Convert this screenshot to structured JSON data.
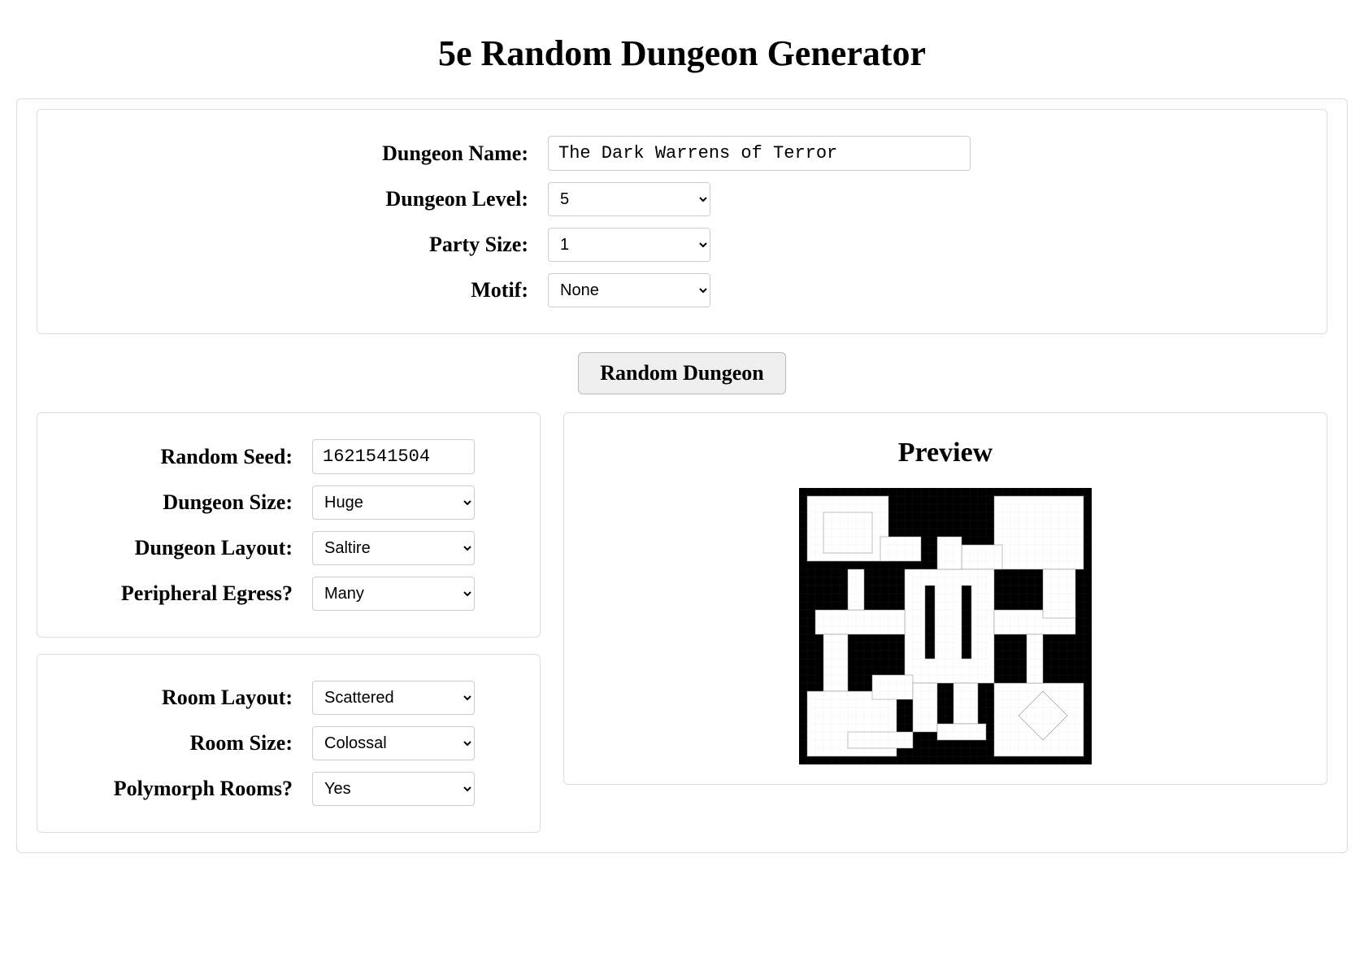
{
  "page_title": "5e Random Dungeon Generator",
  "top": {
    "dungeon_name_label": "Dungeon Name:",
    "dungeon_name_value": "The Dark Warrens of Terror",
    "dungeon_level_label": "Dungeon Level:",
    "dungeon_level_value": "5",
    "party_size_label": "Party Size:",
    "party_size_value": "1",
    "motif_label": "Motif:",
    "motif_value": "None"
  },
  "random_button": "Random Dungeon",
  "left1": {
    "random_seed_label": "Random Seed:",
    "random_seed_value": "1621541504",
    "dungeon_size_label": "Dungeon Size:",
    "dungeon_size_value": "Huge",
    "dungeon_layout_label": "Dungeon Layout:",
    "dungeon_layout_value": "Saltire",
    "peripheral_egress_label": "Peripheral Egress?",
    "peripheral_egress_value": "Many"
  },
  "left2": {
    "room_layout_label": "Room Layout:",
    "room_layout_value": "Scattered",
    "room_size_label": "Room Size:",
    "room_size_value": "Colossal",
    "polymorph_rooms_label": "Polymorph Rooms?",
    "polymorph_rooms_value": "Yes"
  },
  "preview_title": "Preview"
}
